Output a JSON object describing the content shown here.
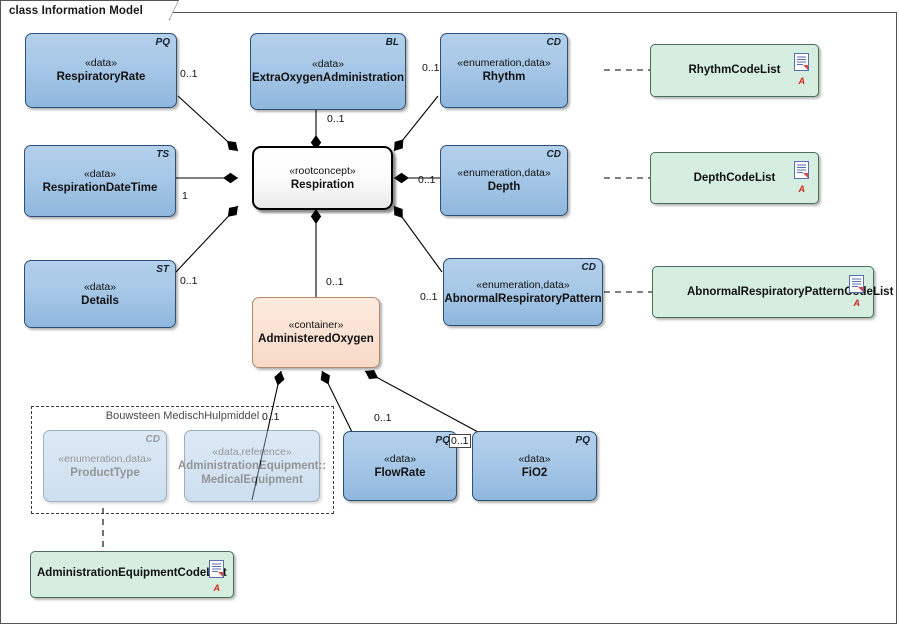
{
  "diagram": {
    "title": "class Information Model",
    "palette": {
      "class_blue": "#a9c9e8",
      "class_blue_border": "#2c4f73",
      "root_white": "#ffffff",
      "container_peach": "#fbe3d4",
      "codelist_green": "#d6eee0",
      "codelist_green_border": "#4a6f58",
      "red_accent": "#d0281e",
      "line_black": "#000000"
    }
  },
  "nodes": {
    "respiratory_rate": {
      "stereotype": "«data»",
      "name": "RespiratoryRate",
      "corner": "PQ",
      "kind": "class"
    },
    "extra_oxygen": {
      "stereotype": "«data»",
      "name": "ExtraOxygenAdministration",
      "corner": "BL",
      "kind": "class"
    },
    "rhythm": {
      "stereotype": "«enumeration,data»",
      "name": "Rhythm",
      "corner": "CD",
      "kind": "enumeration"
    },
    "respiration_date": {
      "stereotype": "«data»",
      "name": "RespirationDateTime",
      "corner": "TS",
      "kind": "class"
    },
    "respiration": {
      "stereotype": "«rootconcept»",
      "name": "Respiration",
      "corner": "",
      "kind": "rootconcept"
    },
    "depth": {
      "stereotype": "«enumeration,data»",
      "name": "Depth",
      "corner": "CD",
      "kind": "enumeration"
    },
    "details": {
      "stereotype": "«data»",
      "name": "Details",
      "corner": "ST",
      "kind": "class"
    },
    "abnormal_pattern": {
      "stereotype": "«enumeration,data»",
      "name": "AbnormalRespiratoryPattern",
      "corner": "CD",
      "kind": "enumeration"
    },
    "administered_oxygen": {
      "stereotype": "«container»",
      "name": "AdministeredOxygen",
      "corner": "",
      "kind": "container"
    },
    "product_type": {
      "stereotype": "«enumeration,data»",
      "name": "ProductType",
      "corner": "CD",
      "kind": "enumeration"
    },
    "medical_equipment": {
      "stereotype": "«data,reference»",
      "name": "AdministrationEquipment::",
      "name2": "MedicalEquipment",
      "corner": "",
      "kind": "class"
    },
    "flow_rate": {
      "stereotype": "«data»",
      "name": "FlowRate",
      "corner": "PQ",
      "kind": "class"
    },
    "fio2": {
      "stereotype": "«data»",
      "name": "FiO2",
      "corner": "PQ",
      "kind": "class"
    }
  },
  "codelists": {
    "rhythm_cl": {
      "name": "RhythmCodeList",
      "icon": "document-icon",
      "badge": "A"
    },
    "depth_cl": {
      "name": "DepthCodeList",
      "icon": "document-icon",
      "badge": "A"
    },
    "abnormal_cl": {
      "name": "AbnormalRespiratoryPatternCodeList",
      "icon": "document-icon",
      "badge": "A"
    },
    "admin_eq_cl": {
      "name": "AdministrationEquipmentCodeList",
      "icon": "document-icon",
      "badge": "A"
    }
  },
  "groups": {
    "medisch_hulpmiddel": {
      "title": "Bouwsteen MedischHulpmiddel"
    }
  },
  "multiplicities": {
    "respiratory_rate": "0..1",
    "extra_oxygen": "0..1",
    "rhythm": "0..1",
    "respiration_date": "1",
    "depth": "0..1",
    "details": "0..1",
    "abnormal_pattern": "0..1",
    "administered_oxygen": "0..1",
    "medical_equipment": "0..1",
    "flow_rate": "0..1",
    "fio2": "0..1"
  }
}
